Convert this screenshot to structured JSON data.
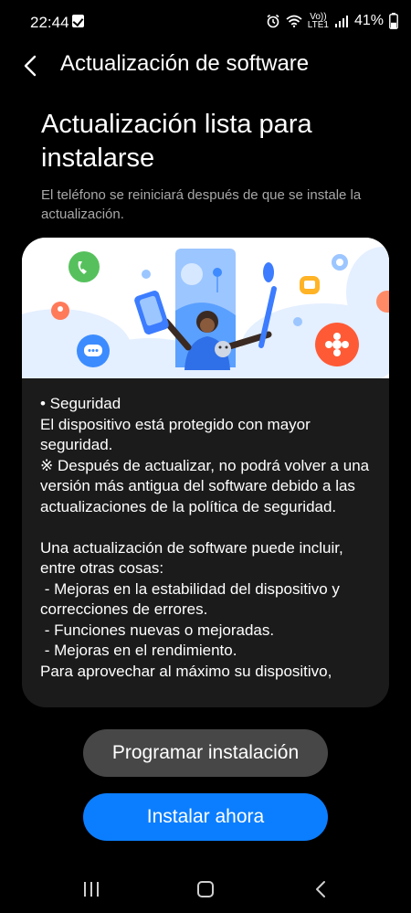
{
  "status_bar": {
    "time": "22:44",
    "volte_top": "Vo))",
    "volte_bottom": "LTE1",
    "battery_percent": "41%",
    "battery_level": 0.41,
    "icons": [
      "notification-check-icon",
      "alarm-icon",
      "wifi-icon",
      "signal-icon",
      "battery-icon"
    ]
  },
  "app_bar": {
    "back_icon": "back-arrow-icon",
    "title": "Actualización de software"
  },
  "headline": "Actualización lista para instalarse",
  "subtext": "El teléfono se reiniciará después de que se instale la actualización.",
  "card": {
    "illustration": "software-update-illustration",
    "notes": "• Seguridad\nEl dispositivo está protegido con mayor seguridad.\n※ Después de actualizar, no podrá volver a una versión más antigua del software debido a las actualizaciones de la política de seguridad.\n\nUna actualización de software puede incluir, entre otras cosas:\n - Mejoras en la estabilidad del dispositivo y correcciones de errores.\n - Funciones nuevas o mejoradas.\n - Mejoras en el rendimiento.\nPara aprovechar al máximo su dispositivo,"
  },
  "buttons": {
    "schedule_label": "Programar instalación",
    "install_label": "Instalar ahora"
  },
  "nav_bar": {
    "icons": [
      "recents-icon",
      "home-icon",
      "back-icon"
    ]
  },
  "colors": {
    "accent": "#0b7eff",
    "secondary_button": "#474747",
    "card_background": "#1b1b1b",
    "background": "#000000"
  }
}
